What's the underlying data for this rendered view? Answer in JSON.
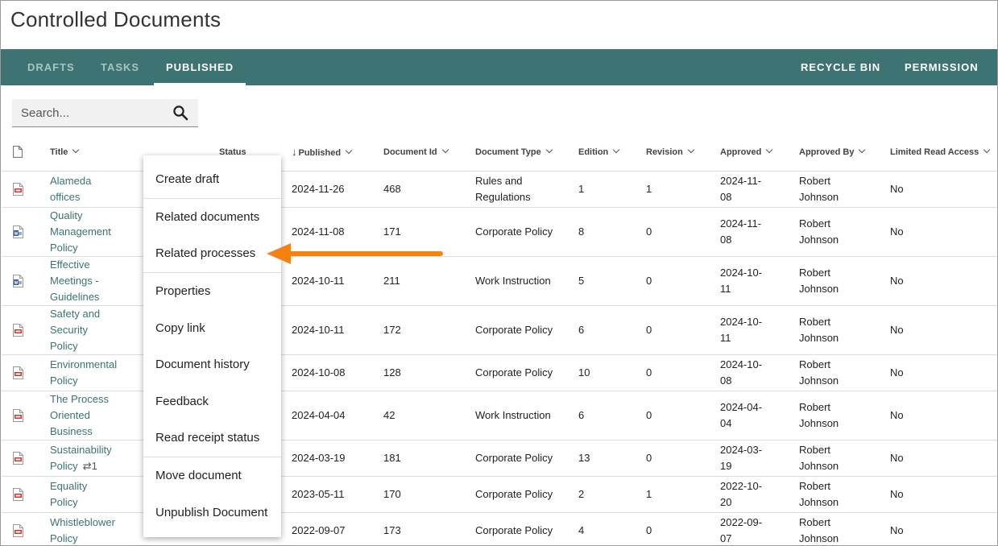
{
  "page": {
    "title": "Controlled Documents"
  },
  "nav": {
    "tabs": [
      {
        "label": "DRAFTS"
      },
      {
        "label": "TASKS"
      },
      {
        "label": "PUBLISHED"
      }
    ],
    "right": [
      {
        "label": "RECYCLE BIN"
      },
      {
        "label": "PERMISSION"
      }
    ]
  },
  "search": {
    "placeholder": "Search..."
  },
  "table": {
    "columns": [
      "Title",
      "Status",
      "Published",
      "Document Id",
      "Document Type",
      "Edition",
      "Revision",
      "Approved",
      "Approved By",
      "Limited Read Access"
    ],
    "rows": [
      {
        "icon": "pdf-icon",
        "title": [
          "Alameda",
          "offices"
        ],
        "link_count": "",
        "published": "2024-11-26",
        "id": "468",
        "type": [
          "Rules and",
          "Regulations"
        ],
        "edition": "1",
        "revision": "1",
        "approved": [
          "2024-11-",
          "08"
        ],
        "approved_by": [
          "Robert",
          "Johnson"
        ],
        "limited": "No"
      },
      {
        "icon": "word-icon",
        "title": [
          "Quality",
          "Management",
          "Policy"
        ],
        "link_count": "",
        "published": "2024-11-08",
        "id": "171",
        "type": [
          "Corporate Policy"
        ],
        "edition": "8",
        "revision": "0",
        "approved": [
          "2024-11-",
          "08"
        ],
        "approved_by": [
          "Robert",
          "Johnson"
        ],
        "limited": "No"
      },
      {
        "icon": "word-icon",
        "title": [
          "Effective",
          "Meetings -",
          "Guidelines"
        ],
        "link_count": "",
        "published": "2024-10-11",
        "id": "211",
        "type": [
          "Work Instruction"
        ],
        "edition": "5",
        "revision": "0",
        "approved": [
          "2024-10-",
          "11"
        ],
        "approved_by": [
          "Robert",
          "Johnson"
        ],
        "limited": "No"
      },
      {
        "icon": "pdf-icon",
        "title": [
          "Safety and",
          "Security",
          "Policy"
        ],
        "link_count": "",
        "published": "2024-10-11",
        "id": "172",
        "type": [
          "Corporate Policy"
        ],
        "edition": "6",
        "revision": "0",
        "approved": [
          "2024-10-",
          "11"
        ],
        "approved_by": [
          "Robert",
          "Johnson"
        ],
        "limited": "No"
      },
      {
        "icon": "pdf-icon",
        "title": [
          "Environmental",
          "Policy"
        ],
        "link_count": "",
        "published": "2024-10-08",
        "id": "128",
        "type": [
          "Corporate Policy"
        ],
        "edition": "10",
        "revision": "0",
        "approved": [
          "2024-10-",
          "08"
        ],
        "approved_by": [
          "Robert",
          "Johnson"
        ],
        "limited": "No"
      },
      {
        "icon": "pdf-icon",
        "title": [
          "The Process",
          "Oriented",
          "Business"
        ],
        "link_count": "",
        "published": "2024-04-04",
        "id": "42",
        "type": [
          "Work Instruction"
        ],
        "edition": "6",
        "revision": "0",
        "approved": [
          "2024-04-",
          "04"
        ],
        "approved_by": [
          "Robert",
          "Johnson"
        ],
        "limited": "No"
      },
      {
        "icon": "pdf-icon",
        "title": [
          "Sustainability",
          "Policy"
        ],
        "link_count": "⇄1",
        "published": "2024-03-19",
        "id": "181",
        "type": [
          "Corporate Policy"
        ],
        "edition": "13",
        "revision": "0",
        "approved": [
          "2024-03-",
          "19"
        ],
        "approved_by": [
          "Robert",
          "Johnson"
        ],
        "limited": "No"
      },
      {
        "icon": "pdf-icon",
        "title": [
          "Equality",
          "Policy"
        ],
        "link_count": "",
        "published": "2023-05-11",
        "id": "170",
        "type": [
          "Corporate Policy"
        ],
        "edition": "2",
        "revision": "1",
        "approved": [
          "2022-10-",
          "20"
        ],
        "approved_by": [
          "Robert",
          "Johnson"
        ],
        "limited": "No"
      },
      {
        "icon": "pdf-icon",
        "title": [
          "Whistleblower",
          "Policy"
        ],
        "link_count": "",
        "published": "2022-09-07",
        "id": "173",
        "type": [
          "Corporate Policy"
        ],
        "edition": "4",
        "revision": "0",
        "approved": [
          "2022-09-",
          "07"
        ],
        "approved_by": [
          "Robert",
          "Johnson"
        ],
        "limited": "No"
      }
    ]
  },
  "context_menu": {
    "items": [
      {
        "label": "Create draft"
      },
      {
        "label": "Related documents"
      },
      {
        "label": "Related processes"
      },
      {
        "label": "Properties"
      },
      {
        "label": "Copy link"
      },
      {
        "label": "Document history"
      },
      {
        "label": "Feedback"
      },
      {
        "label": "Read receipt status"
      },
      {
        "label": "Move document"
      },
      {
        "label": "Unpublish Document"
      }
    ]
  },
  "colors": {
    "nav_bg": "#3e7373",
    "link": "#3b7373",
    "arrow": "#f5820f",
    "pdf": "#c8382c",
    "word": "#2b579a"
  }
}
